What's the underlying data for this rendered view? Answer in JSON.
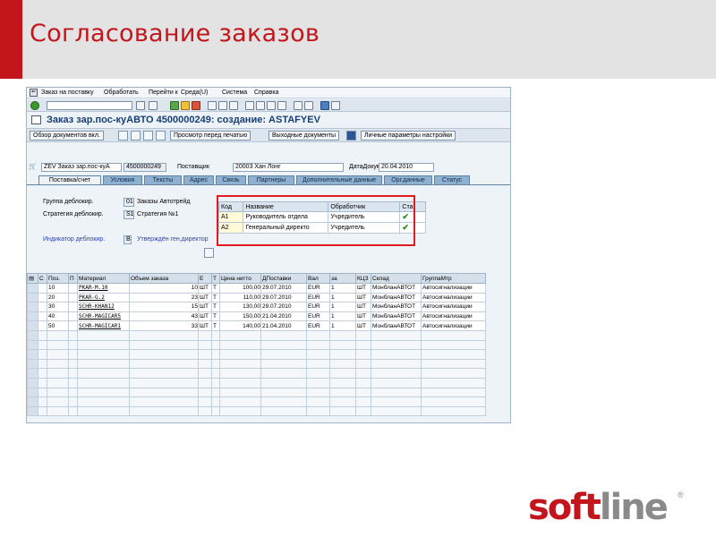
{
  "slide": {
    "title": "Согласование заказов",
    "accent_color": "#c2161c",
    "logo_soft": "soft",
    "logo_line": "line",
    "logo_reg": "®"
  },
  "sap": {
    "menu": [
      "Заказ на поставку",
      "Обработать",
      "Перейти к",
      "Среда(U)",
      "Система",
      "Справка"
    ],
    "screen_title": "Заказ зар.пос-куАВТО 4500000249: создание: ASTAFYEV",
    "app_toolbar": {
      "overview": "Обзор документов вкл.",
      "print_preview": "Просмотр перед печатью",
      "output": "Выходные документы",
      "settings": "Личные параметры настройки"
    },
    "header": {
      "doc_type": "ZEV Заказ зар.пос-куА",
      "po_number": "4500000249",
      "vendor_label": "Поставщик",
      "vendor_value": "20003 Хан Лонг",
      "date_label": "ДатаДокум",
      "date_value": "20.04.2010"
    },
    "tabs": [
      "Поставка/счет",
      "Условия",
      "Тексты",
      "Адрес",
      "Связь",
      "Партнеры",
      "Дополнительные данные",
      "Орг.данные",
      "Статус"
    ],
    "release": {
      "group_label": "Группа деблокир.",
      "group_code": "01",
      "group_text": "Заказы Автотрейд",
      "strategy_label": "Стратегия деблокир.",
      "strategy_code": "S1",
      "strategy_text": "Стратегия №1",
      "indicator_label": "Индикатор деблокир.",
      "indicator_code": "B",
      "indicator_text": "Утверждён ген.директор"
    },
    "release_table": {
      "headers": [
        "Код",
        "Название",
        "Обработчик",
        "Ста"
      ],
      "rows": [
        [
          "A1",
          "Руководитель отдела",
          "Учредитель",
          "✔"
        ],
        [
          "A2",
          "Генеральный директо",
          "Учредитель",
          "✔"
        ]
      ]
    },
    "items": {
      "headers": [
        "С",
        "Поз.",
        "П",
        "Материал",
        "Объем заказа",
        "Е",
        "Т",
        "Цена нетто",
        "ДПоставки",
        "Вал",
        "за",
        "КЦЗ",
        "Склад",
        "ГруппаМтр"
      ],
      "rows": [
        [
          "",
          "10",
          "",
          "PKAR-M.10",
          "10",
          "ШТ",
          "T",
          "100,00",
          "29.07.2010",
          "EUR",
          "1",
          "ШТ",
          "МонбланАВТОТ",
          "Автосигнализации"
        ],
        [
          "",
          "20",
          "",
          "PKAR-G.2",
          "23",
          "ШТ",
          "T",
          "110,00",
          "29.07.2010",
          "EUR",
          "1",
          "ШТ",
          "МонбланАВТОТ",
          "Автосигнализации"
        ],
        [
          "",
          "30",
          "",
          "SCHR-KHAN12",
          "15",
          "ШТ",
          "T",
          "130,00",
          "29.07.2010",
          "EUR",
          "1",
          "ШТ",
          "МонбланАВТОТ",
          "Автосигнализации"
        ],
        [
          "",
          "40",
          "",
          "SCHR-MAGICAR5",
          "43",
          "ШТ",
          "T",
          "150,00",
          "21.04.2010",
          "EUR",
          "1",
          "ШТ",
          "МонбланАВТОТ",
          "Автосигнализации"
        ],
        [
          "",
          "50",
          "",
          "SCHR-MAGICAR1",
          "33",
          "ШТ",
          "T",
          "140,00",
          "21.04.2010",
          "EUR",
          "1",
          "ШТ",
          "МонбланАВТОТ",
          "Автосигнализации"
        ]
      ],
      "empty_rows": 9
    }
  }
}
